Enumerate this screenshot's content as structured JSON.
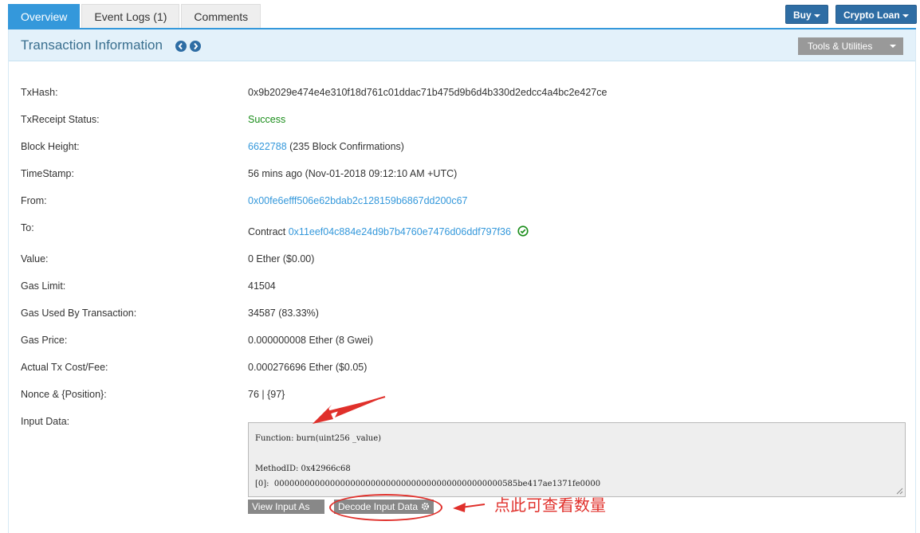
{
  "tabs": [
    {
      "label": "Overview"
    },
    {
      "label": "Event Logs (1)"
    },
    {
      "label": "Comments"
    }
  ],
  "header_buttons": {
    "buy": "Buy",
    "crypto_loan": "Crypto Loan"
  },
  "panel": {
    "title": "Transaction Information",
    "tools_label": "Tools & Utilities"
  },
  "rows": {
    "txhash": {
      "label": "TxHash:",
      "value": "0x9b2029e474e4e310f18d761c01ddac71b475d9b6d4b330d2edcc4a4bc2e427ce"
    },
    "status": {
      "label": "TxReceipt Status:",
      "value": "Success"
    },
    "block": {
      "label": "Block Height:",
      "value": "6622788",
      "suffix": " (235 Block Confirmations)"
    },
    "timestamp": {
      "label": "TimeStamp:",
      "value": "56 mins ago (Nov-01-2018 09:12:10 AM +UTC)"
    },
    "from": {
      "label": "From:",
      "value": "0x00fe6efff506e62bdab2c128159b6867dd200c67"
    },
    "to": {
      "label": "To:",
      "prefix": "Contract ",
      "value": "0x11eef04c884e24d9b7b4760e7476d06ddf797f36"
    },
    "value": {
      "label": "Value:",
      "value": "0 Ether ($0.00)"
    },
    "gas_limit": {
      "label": "Gas Limit:",
      "value": "41504"
    },
    "gas_used": {
      "label": "Gas Used By Transaction:",
      "value": "34587 (83.33%)"
    },
    "gas_price": {
      "label": "Gas Price:",
      "value": "0.000000008 Ether (8 Gwei)"
    },
    "fee": {
      "label": "Actual Tx Cost/Fee:",
      "value": "0.000276696 Ether ($0.05)"
    },
    "nonce": {
      "label": "Nonce & {Position}:",
      "value": "76 | {97}"
    },
    "input": {
      "label": "Input Data:"
    }
  },
  "input_data": {
    "function": "Function: burn(uint256 _value)",
    "method_id": "MethodID: 0x42966c68",
    "param0": "[0]:  000000000000000000000000000000000000000000000585be417ae1371fe0000"
  },
  "buttons": {
    "view_input_as": "View Input As",
    "decode_input": "Decode Input Data"
  },
  "annotation": "点此可查看数量",
  "colors": {
    "accent": "#3498db",
    "success": "#1a8d1a",
    "annotation": "#e0302b"
  },
  "icons": {
    "prev": "chevron-left-circle-icon",
    "next": "chevron-right-circle-icon",
    "verified": "check-circle-icon",
    "gear": "gear-icon"
  }
}
